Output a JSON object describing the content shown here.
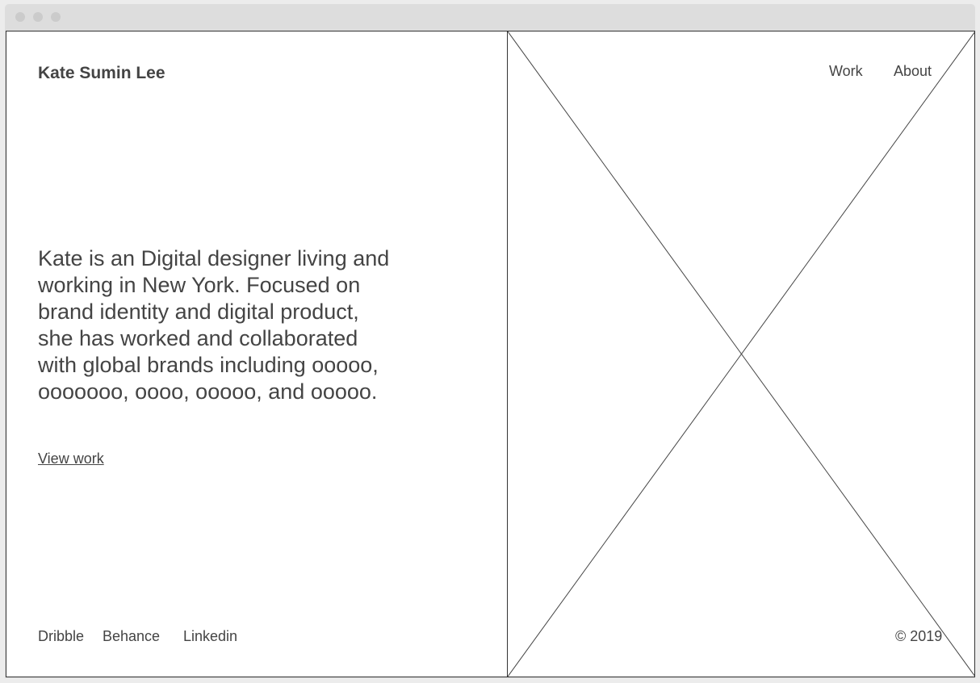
{
  "site": {
    "name": "Kate Sumin Lee"
  },
  "hero": {
    "bio": "Kate is an Digital designer living and working in New York. Focused on brand identity and digital product, she has worked and collaborated with global brands including ooooo, ooooooo, oooo, ooooo, and ooooo.",
    "cta_label": "View work"
  },
  "social": {
    "items": [
      {
        "label": "Dribble"
      },
      {
        "label": "Behance"
      },
      {
        "label": "Linkedin"
      }
    ]
  },
  "nav": {
    "items": [
      {
        "label": "Work"
      },
      {
        "label": "About"
      }
    ]
  },
  "footer": {
    "copyright": "© 2019"
  },
  "image_placeholder": {
    "icon": "image-placeholder-cross-icon"
  },
  "colors": {
    "text": "#444444",
    "frame": "#dddddd",
    "border": "#333333",
    "background": "#ffffff"
  }
}
